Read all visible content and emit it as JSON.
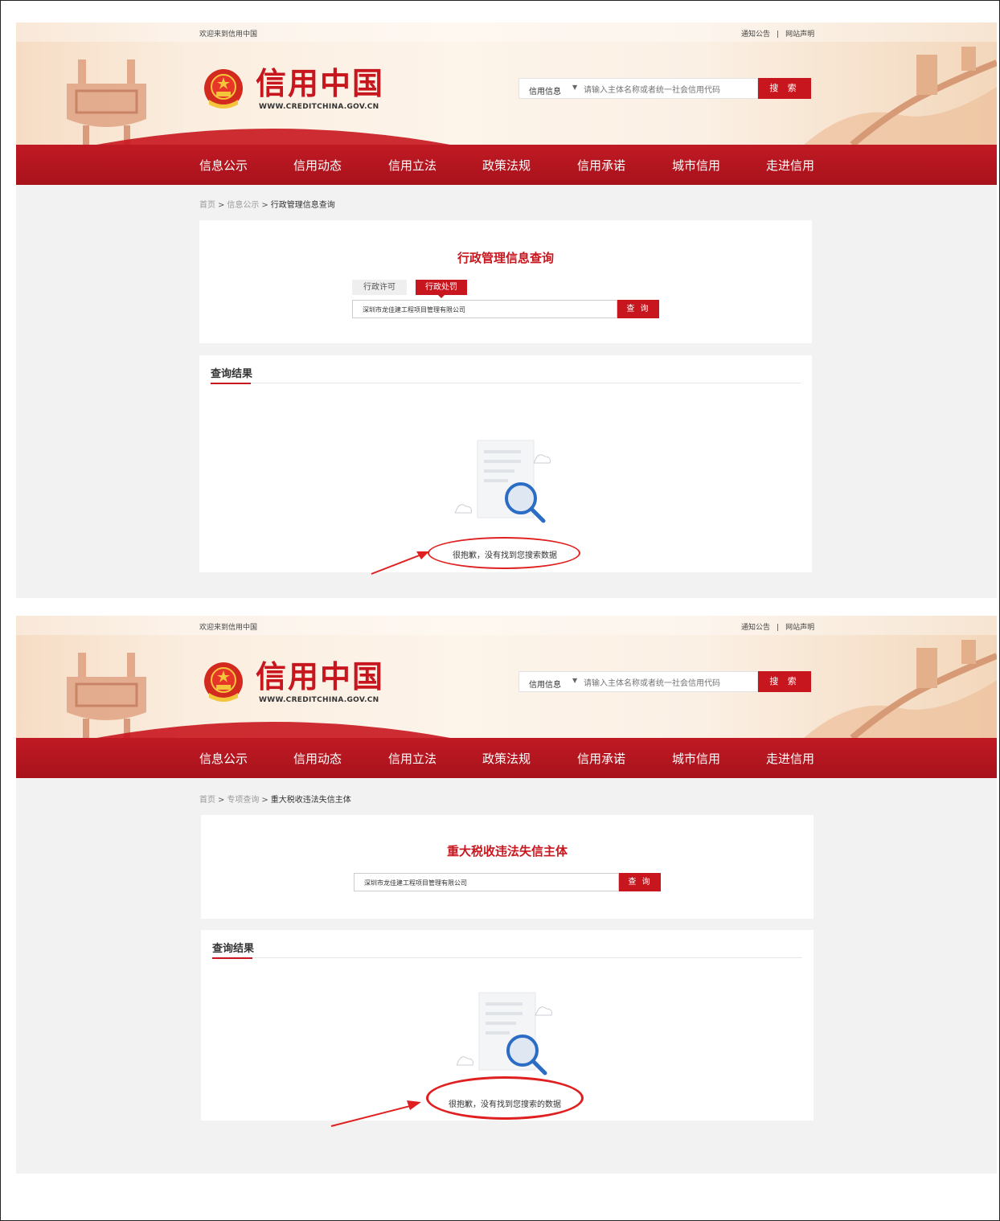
{
  "screen1": {
    "topbar": {
      "welcome": "欢迎来到信用中国",
      "notice": "通知公告",
      "divider": "|",
      "statement": "网站声明"
    },
    "logo": {
      "title": "信用中国",
      "url": "WWW.CREDITCHINA.GOV.CN"
    },
    "search": {
      "category": "信用信息",
      "placeholder": "请输入主体名称或者统一社会信用代码",
      "button": "搜 索"
    },
    "nav": [
      "信息公示",
      "信用动态",
      "信用立法",
      "政策法规",
      "信用承诺",
      "城市信用",
      "走进信用"
    ],
    "breadcrumb": {
      "home": "首页",
      "sep1": ">",
      "level2": "信息公示",
      "sep2": ">",
      "current": "行政管理信息查询"
    },
    "query": {
      "title": "行政管理信息查询",
      "tabs": [
        "行政许可",
        "行政处罚"
      ],
      "active_tab": "行政处罚",
      "input_value": "深圳市龙佳建工程项目管理有限公司",
      "button": "查 询"
    },
    "results": {
      "title": "查询结果",
      "empty_message": "很抱歉，没有找到您搜索数据"
    }
  },
  "screen2": {
    "topbar": {
      "welcome": "欢迎来到信用中国",
      "notice": "通知公告",
      "divider": "|",
      "statement": "网站声明"
    },
    "logo": {
      "title": "信用中国",
      "url": "WWW.CREDITCHINA.GOV.CN"
    },
    "search": {
      "category": "信用信息",
      "placeholder": "请输入主体名称或者统一社会信用代码",
      "button": "搜 索"
    },
    "nav": [
      "信息公示",
      "信用动态",
      "信用立法",
      "政策法规",
      "信用承诺",
      "城市信用",
      "走进信用"
    ],
    "breadcrumb": {
      "home": "首页",
      "sep1": ">",
      "level2": "专项查询",
      "sep2": ">",
      "current": "重大税收违法失信主体"
    },
    "query": {
      "title": "重大税收违法失信主体",
      "input_value": "深圳市龙佳建工程项目管理有限公司",
      "button": "查 询"
    },
    "results": {
      "title": "查询结果",
      "empty_message": "很抱歉，没有找到您搜索的数据"
    }
  },
  "colors": {
    "brand_red": "#c8161e",
    "annotation_red": "#e02020",
    "page_bg": "#f2f2f2"
  },
  "icons": [
    "national-emblem-icon",
    "dropdown-caret-icon",
    "empty-result-magnifier-icon"
  ]
}
